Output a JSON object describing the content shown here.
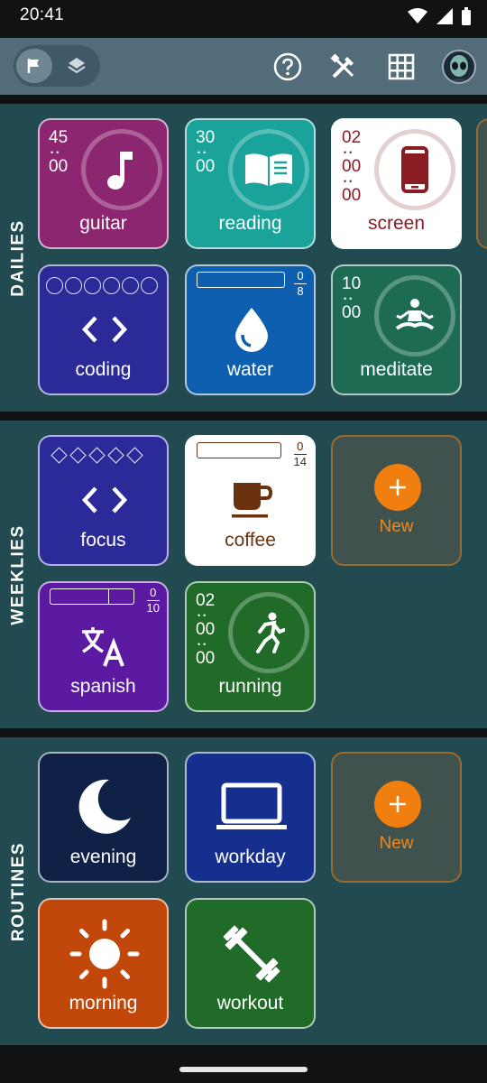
{
  "status_bar": {
    "time": "20:41"
  },
  "app_bar": {
    "view_toggle": [
      "flag-icon",
      "layers-icon"
    ],
    "actions": [
      "help-icon",
      "tools-icon",
      "grid-icon"
    ],
    "avatar": "alien-avatar"
  },
  "colors": {
    "section_bg": "#224a51",
    "app_bar": "#526c79",
    "accent_orange": "#f07f10"
  },
  "sections": [
    {
      "label": "DAILIES",
      "tiles": [
        {
          "label": "guitar",
          "time": [
            "45",
            "00"
          ],
          "icon": "music-note-icon",
          "color": "#8d2670"
        },
        {
          "label": "reading",
          "time": [
            "30",
            "00"
          ],
          "icon": "book-icon",
          "color": "#1aa39a"
        },
        {
          "label": "screen",
          "time": [
            "02",
            "00",
            "00"
          ],
          "icon": "phone-icon",
          "color": "#ffffff"
        },
        {
          "label": "coding",
          "progress_circles": 6,
          "icon": "code-icon",
          "color": "#2b2a98"
        },
        {
          "label": "water",
          "counter": {
            "value": "0",
            "total": "8"
          },
          "icon": "drop-icon",
          "color": "#0f5fb0"
        },
        {
          "label": "meditate",
          "time": [
            "10",
            "00"
          ],
          "icon": "meditate-icon",
          "color": "#1c6b52"
        }
      ]
    },
    {
      "label": "WEEKLIES",
      "tiles": [
        {
          "label": "focus",
          "progress_diamonds": 5,
          "icon": "code-icon",
          "color": "#2b2a98"
        },
        {
          "label": "coffee",
          "counter": {
            "value": "0",
            "total": "14"
          },
          "icon": "coffee-icon",
          "color": "#ffffff"
        },
        {
          "label": "New",
          "icon": "plus-icon"
        },
        {
          "label": "spanish",
          "counter": {
            "value": "0",
            "total": "10"
          },
          "icon": "translate-icon",
          "color": "#5c1aa3"
        },
        {
          "label": "running",
          "time": [
            "02",
            "00",
            "00"
          ],
          "icon": "running-icon",
          "color": "#1f6b27"
        }
      ]
    },
    {
      "label": "ROUTINES",
      "tiles": [
        {
          "label": "evening",
          "icon": "moon-icon",
          "color": "#0f2147"
        },
        {
          "label": "workday",
          "icon": "laptop-icon",
          "color": "#152f8e"
        },
        {
          "label": "New",
          "icon": "plus-icon"
        },
        {
          "label": "morning",
          "icon": "sun-icon",
          "color": "#c2470a"
        },
        {
          "label": "workout",
          "icon": "dumbbell-icon",
          "color": "#1f6b27"
        }
      ]
    }
  ]
}
